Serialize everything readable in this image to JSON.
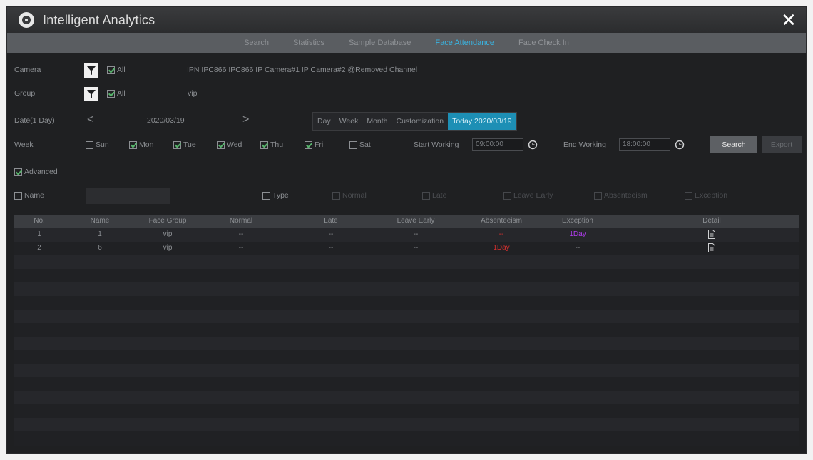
{
  "window": {
    "title": "Intelligent Analytics",
    "close_symbol": "✕"
  },
  "tabs": [
    {
      "label": "Search",
      "active": false
    },
    {
      "label": "Statistics",
      "active": false
    },
    {
      "label": "Sample Database",
      "active": false
    },
    {
      "label": "Face Attendance",
      "active": true
    },
    {
      "label": "Face Check In",
      "active": false
    }
  ],
  "camera": {
    "label": "Camera",
    "all_label": "All",
    "value": "IPN IPC866 IPC866 IP Camera#1 IP Camera#2 @Removed Channel"
  },
  "group": {
    "label": "Group",
    "all_label": "All",
    "value": "vip"
  },
  "date": {
    "label": "Date(1 Day)",
    "value": "2020/03/19",
    "prev": "<",
    "next": ">",
    "periods": [
      "Day",
      "Week",
      "Month",
      "Customization",
      "Today 2020/03/19"
    ]
  },
  "week": {
    "label": "Week",
    "days": [
      {
        "label": "Sun",
        "checked": false
      },
      {
        "label": "Mon",
        "checked": true
      },
      {
        "label": "Tue",
        "checked": true
      },
      {
        "label": "Wed",
        "checked": true
      },
      {
        "label": "Thu",
        "checked": true
      },
      {
        "label": "Fri",
        "checked": true
      },
      {
        "label": "Sat",
        "checked": false
      }
    ],
    "start_label": "Start Working",
    "start_value": "09:00:00",
    "end_label": "End Working",
    "end_value": "18:00:00",
    "search_label": "Search",
    "export_label": "Export"
  },
  "advanced": {
    "label": "Advanced",
    "checked": true
  },
  "filters": {
    "name_label": "Name",
    "type_label": "Type",
    "types": [
      "Normal",
      "Late",
      "Leave Early",
      "Absenteeism",
      "Exception"
    ]
  },
  "table": {
    "columns": [
      "No.",
      "Name",
      "Face Group",
      "Normal",
      "Late",
      "Leave Early",
      "Absenteeism",
      "Exception",
      "Detail"
    ],
    "rows": [
      {
        "no": "1",
        "name": "1",
        "group": "vip",
        "normal": "--",
        "late": "--",
        "leave_early": "--",
        "absenteeism": "--",
        "exception": "1Day"
      },
      {
        "no": "2",
        "name": "6",
        "group": "vip",
        "normal": "--",
        "late": "--",
        "leave_early": "--",
        "absenteeism": "1Day",
        "exception": "--"
      }
    ],
    "colors": {
      "absenteeism": "#d8302f",
      "exception": "#b23cf0",
      "accent": "#1d8fb5"
    }
  }
}
